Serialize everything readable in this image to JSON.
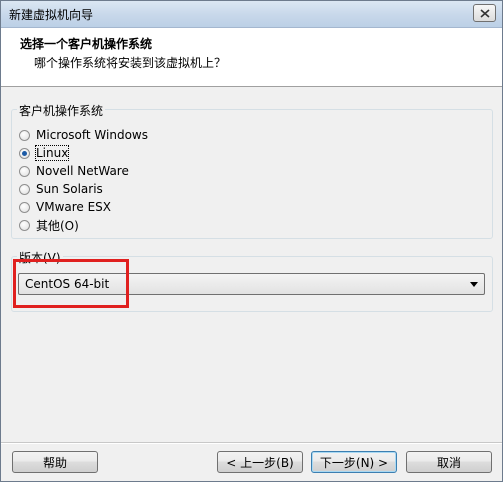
{
  "window": {
    "title": "新建虚拟机向导"
  },
  "header": {
    "title": "选择一个客户机操作系统",
    "subtitle": "哪个操作系统将安装到该虚拟机上？"
  },
  "os_group": {
    "label": "客户机操作系统",
    "options": [
      {
        "label": "Microsoft Windows",
        "selected": false
      },
      {
        "label": "Linux",
        "selected": true
      },
      {
        "label": "Novell NetWare",
        "selected": false
      },
      {
        "label": "Sun Solaris",
        "selected": false
      },
      {
        "label": "VMware ESX",
        "selected": false
      },
      {
        "label": "其他(O)",
        "selected": false
      }
    ]
  },
  "version_group": {
    "label": "版本(V)",
    "selected_value": "CentOS 64-bit"
  },
  "buttons": {
    "help": "帮助",
    "back": "< 上一步(B)",
    "next": "下一步(N) >",
    "cancel": "取消"
  },
  "colors": {
    "highlight": "#e0201f",
    "radio_selected": "#1c5aa5"
  }
}
